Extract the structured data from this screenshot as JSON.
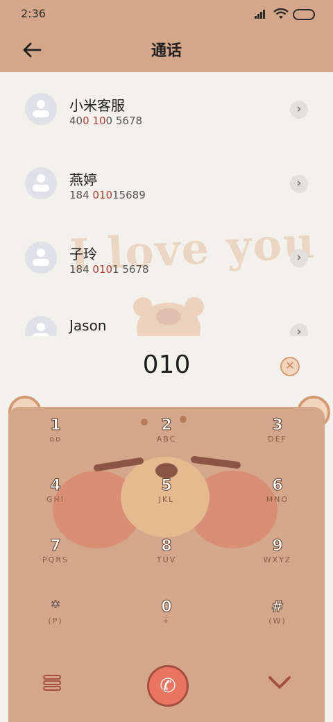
{
  "status_bar": {
    "time": "2:36"
  },
  "header": {
    "title": "通话"
  },
  "contacts": [
    {
      "name": "小米客服",
      "number_parts": [
        "40",
        "0",
        " ",
        "10",
        "0 5678"
      ],
      "highlight": [
        false,
        true,
        false,
        true,
        false
      ]
    },
    {
      "name": "燕婷",
      "number_parts": [
        "184 ",
        "010",
        "15689"
      ],
      "highlight": [
        false,
        true,
        false
      ]
    },
    {
      "name": "子玲",
      "number_parts": [
        "184 ",
        "010",
        "1 5678"
      ],
      "highlight": [
        false,
        true,
        false
      ]
    },
    {
      "name": "Jason",
      "number_parts": [],
      "highlight": []
    }
  ],
  "dialer": {
    "input": "010"
  },
  "decor": {
    "text": "I love you"
  },
  "keypad": [
    {
      "digit": "1",
      "letters": "oo"
    },
    {
      "digit": "2",
      "letters": "ABC"
    },
    {
      "digit": "3",
      "letters": "DEF"
    },
    {
      "digit": "4",
      "letters": "GHI"
    },
    {
      "digit": "5",
      "letters": "JKL"
    },
    {
      "digit": "6",
      "letters": "MNO"
    },
    {
      "digit": "7",
      "letters": "PQRS"
    },
    {
      "digit": "8",
      "letters": "TUV"
    },
    {
      "digit": "9",
      "letters": "WXYZ"
    },
    {
      "digit": "*",
      "letters": "(P)"
    },
    {
      "digit": "0",
      "letters": "+"
    },
    {
      "digit": "#",
      "letters": "(W)"
    }
  ],
  "colors": {
    "accent": "#d5a78a",
    "highlight": "#b33b36",
    "call": "#e97460"
  }
}
